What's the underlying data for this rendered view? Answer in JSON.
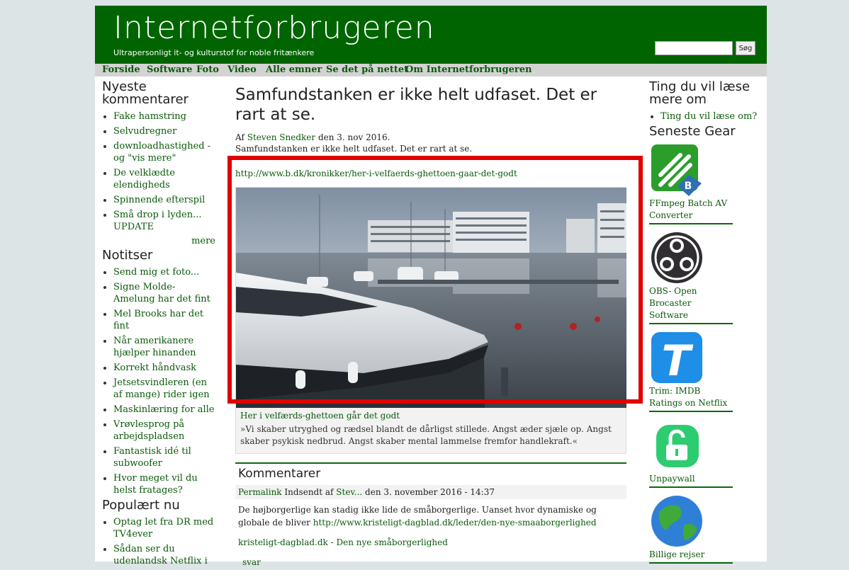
{
  "header": {
    "title": "Internetforbrugeren",
    "subtitle": "Ultrapersonligt it- og kulturstof for noble fritænkere",
    "search_button": "Søg",
    "search_value": ""
  },
  "nav": [
    "Forside",
    "Software",
    "Foto",
    "Video",
    "Alle emner",
    "Se det på nettet",
    "Om Internetforbrugeren"
  ],
  "left": {
    "newest_comments_title": "Nyeste kommentarer",
    "newest_comments": [
      "Fake hamstring",
      "Selvudregner",
      "downloadhastighed - og \"vis mere\"",
      "De velklædte elendigheds",
      "Spinnende efterspil",
      "Små drop i lyden... UPDATE"
    ],
    "more": "mere",
    "notes_title": "Notitser",
    "notes": [
      "Send mig et foto...",
      "Signe Molde-Amelung har det fint",
      "Mel Brooks har det fint",
      "Når amerikanere hjælper hinanden",
      "Korrekt håndvask",
      "Jetsetsvindleren (en af mange) rider igen",
      "Maskinlæring for alle",
      "Vrøvlesprog på arbejdspladsen",
      "Fantastisk idé til subwoofer",
      "Hvor meget vil du helst fratages?"
    ],
    "popular_title": "Populært nu",
    "popular": [
      "Optag let fra DR med TV4ever",
      "Sådan ser du udenlandsk Netflix i"
    ]
  },
  "post": {
    "title": "Samfundstanken er ikke helt udfaset. Det er rart at se.",
    "meta_prefix": "Af ",
    "author": "Steven Snedker",
    "meta_suffix": " den 3. nov 2016.",
    "summary": "Samfundstanken er ikke helt udfaset. Det er rart at se.",
    "url": "http://www.b.dk/kronikker/her-i-velfaerds-ghettoen-gaar-det-godt",
    "card_title": "Her i velfærds-ghettoen går det godt",
    "card_quote": "»Vi skaber utryghed og rædsel blandt de dårligst stillede. Angst æder sjæle op. Angst skaber psykisk nedbrud. Angst skaber mental lammelse fremfor handlekraft.«"
  },
  "comments": {
    "title": "Kommentarer",
    "permalink": "Permalink",
    "meta_mid": " Indsendt af ",
    "author": "Stev...",
    "meta_date": " den 3. november 2016 - 14:37",
    "body_text": "De højborgerlige kan stadig ikke lide de småborgerlige. Uanset hvor dynamiske og globale de bliver ",
    "body_link": "http://www.kristeligt-dagblad.dk/leder/den-nye-smaaborgerlighed",
    "link_title": "kristeligt-dagblad.dk - Den nye småborgerlighed",
    "reply": "svar"
  },
  "right": {
    "read_title": "Ting du vil læse mere om",
    "read_items": [
      "Ting du vil læse om?"
    ],
    "gear_title": "Seneste Gear",
    "gear": [
      {
        "label": "FFmpeg Batch AV Converter",
        "icon": "ffmpeg-batch-icon"
      },
      {
        "label": "OBS- Open Brocaster Software",
        "icon": "obs-icon"
      },
      {
        "label": "Trim: IMDB Ratings on Netflix",
        "icon": "trim-icon"
      },
      {
        "label": "Unpaywall",
        "icon": "unpaywall-icon"
      },
      {
        "label": "Billige rejser",
        "icon": "globe-icon"
      }
    ]
  },
  "colors": {
    "header_bg": "#006400",
    "link": "#0a5a0a",
    "highlight": "#e00000"
  }
}
